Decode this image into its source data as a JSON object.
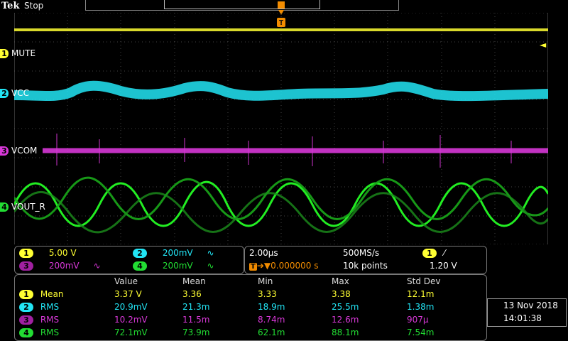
{
  "header": {
    "brand": "Tek",
    "status": "Stop"
  },
  "trigger": {
    "marker": "T",
    "level_marker": "◄"
  },
  "channels": [
    {
      "num": "1",
      "label": "MUTE",
      "color": "#ffff33"
    },
    {
      "num": "2",
      "label": "VCC",
      "color": "#22e5f5"
    },
    {
      "num": "3",
      "label": "VCOM",
      "color": "#d838d8"
    },
    {
      "num": "4",
      "label": "VOUT_R",
      "color": "#22dd33"
    }
  ],
  "vertical": {
    "ch1": "5.00 V",
    "ch2": "200mV",
    "ch3": "200mV",
    "ch4": "200mV",
    "bw_icon": "∿"
  },
  "horizontal": {
    "timebase": "2.00μs",
    "sample_rate": "500MS/s",
    "delay": "0.000000 s",
    "record_length": "10k points",
    "trig_source": "1",
    "trig_slope": "⁄",
    "trig_level": "1.20 V"
  },
  "measurements": {
    "headers": [
      "Value",
      "Mean",
      "Min",
      "Max",
      "Std Dev"
    ],
    "rows": [
      {
        "ch": "1",
        "type": "Mean",
        "value": "3.37 V",
        "mean": "3.36",
        "min": "3.33",
        "max": "3.38",
        "std": "12.1m"
      },
      {
        "ch": "2",
        "type": "RMS",
        "value": "20.9mV",
        "mean": "21.3m",
        "min": "18.9m",
        "max": "25.5m",
        "std": "1.38m"
      },
      {
        "ch": "3",
        "type": "RMS",
        "value": "10.2mV",
        "mean": "11.5m",
        "min": "8.74m",
        "max": "12.6m",
        "std": "907μ"
      },
      {
        "ch": "4",
        "type": "RMS",
        "value": "72.1mV",
        "mean": "73.9m",
        "min": "62.1m",
        "max": "88.1m",
        "std": "7.54m"
      }
    ]
  },
  "clock": {
    "date": "13 Nov 2018",
    "time": "14:01:38"
  }
}
